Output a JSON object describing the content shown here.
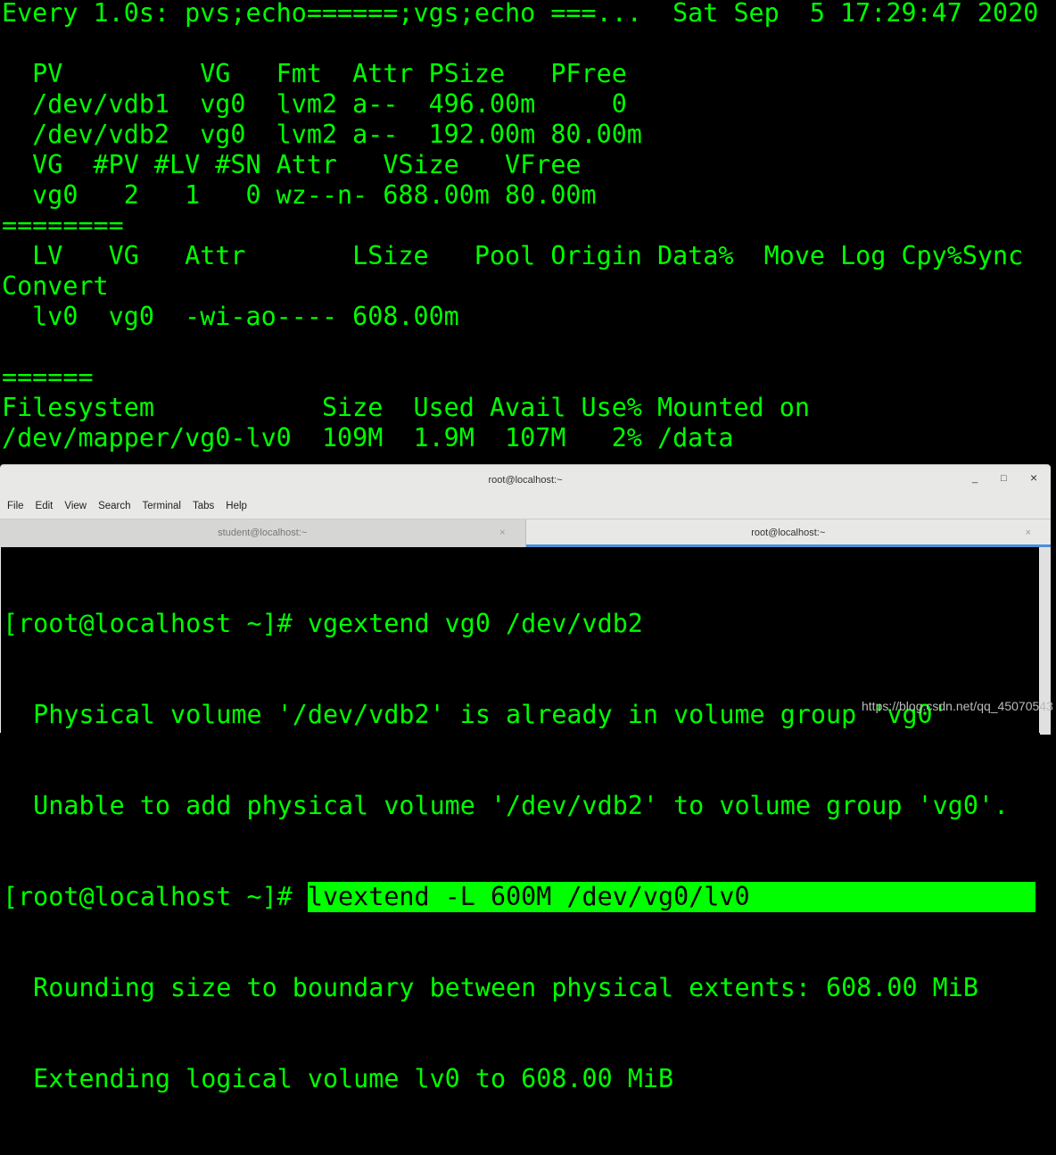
{
  "watch_output": [
    "Every 1.0s: pvs;echo======;vgs;echo ===...  Sat Sep  5 17:29:47 2020",
    "",
    "  PV         VG   Fmt  Attr PSize   PFree ",
    "  /dev/vdb1  vg0  lvm2 a--  496.00m     0 ",
    "  /dev/vdb2  vg0  lvm2 a--  192.00m 80.00m",
    "  VG  #PV #LV #SN Attr   VSize   VFree ",
    "  vg0   2   1   0 wz--n- 688.00m 80.00m",
    "========",
    "  LV   VG   Attr       LSize   Pool Origin Data%  Move Log Cpy%Sync",
    "Convert",
    "  lv0  vg0  -wi-ao---- 608.00m",
    "",
    "======",
    "Filesystem           Size  Used Avail Use% Mounted on",
    "/dev/mapper/vg0-lv0  109M  1.9M  107M   2% /data"
  ],
  "window": {
    "title": "root@localhost:~",
    "minimize": "_",
    "maximize": "□",
    "close": "×",
    "menu": [
      "File",
      "Edit",
      "View",
      "Search",
      "Terminal",
      "Tabs",
      "Help"
    ],
    "tabs": [
      {
        "label": "student@localhost:~",
        "close": "×"
      },
      {
        "label": "root@localhost:~",
        "close": "×"
      }
    ]
  },
  "terminal": {
    "lines": [
      "[root@localhost ~]# vgextend vg0 /dev/vdb2",
      "  Physical volume '/dev/vdb2' is already in volume group 'vg0'",
      "  Unable to add physical volume '/dev/vdb2' to volume group 'vg0'."
    ],
    "prompt": "[root@localhost ~]# ",
    "selected_command": "lvextend -L 600M /dev/vg0/lv0",
    "after": [
      "  Rounding size to boundary between physical extents: 608.00 MiB",
      "  Extending logical volume lv0 to 608.00 MiB"
    ]
  },
  "watermark": "https://blog.csdn.net/qq_45070543",
  "colors": {
    "terminal_fg": "#00ff00",
    "terminal_bg": "#000000",
    "active_tab_accent": "#4a90d9"
  }
}
